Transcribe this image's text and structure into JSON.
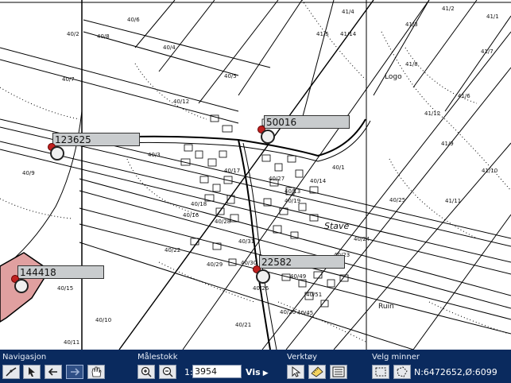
{
  "map": {
    "parcel_labels": [
      "40/7",
      "40/6",
      "40/5",
      "40/3",
      "40/4",
      "40/8",
      "40/12",
      "40/16",
      "40/18",
      "40/15",
      "40/22",
      "40/28",
      "40/21",
      "40/20",
      "40/19",
      "40/29",
      "40/31",
      "40/30",
      "40/45",
      "40/49",
      "40/51",
      "40/13",
      "40/14",
      "40/1",
      "40/2",
      "40/9",
      "40/10",
      "40/11",
      "40/17",
      "40/27",
      "40/23",
      "40/24",
      "40/25",
      "41/5",
      "41/4",
      "41/3",
      "41/2",
      "41/1",
      "41/6",
      "41/14",
      "41/7",
      "41/8",
      "41/9",
      "41/10",
      "41/11",
      "41/12",
      "40/26"
    ],
    "place_name": "Stave",
    "feature_labels": [
      "Ruin",
      "Logo"
    ],
    "markers": [
      {
        "id": "123625",
        "label": "123625"
      },
      {
        "id": "50016",
        "label": "50016"
      },
      {
        "id": "22582",
        "label": "22582"
      },
      {
        "id": "144418",
        "label": "144418"
      }
    ]
  },
  "toolbar": {
    "navigation": {
      "title": "Navigasjon",
      "buttons": [
        "draw-line-icon",
        "select-arrow-icon",
        "back-arrow-icon",
        "forward-arrow-icon",
        "pan-hand-icon"
      ]
    },
    "scale": {
      "title": "Målestokk",
      "prefix": "1:",
      "value": "3954",
      "submit_label": "Vis"
    },
    "tools": {
      "title": "Verktøy",
      "buttons": [
        "pointer-icon",
        "ruler-icon",
        "list-icon"
      ]
    },
    "select_monuments": {
      "title": "Velg minner",
      "buttons": [
        "rectangle-select-icon",
        "polygon-select-icon"
      ]
    },
    "coordinates": "N:6472652,Ø:6099"
  },
  "colors": {
    "toolbar_bg": "#0a2a5e",
    "marker_label_bg": "#c9ccce",
    "marker_dot": "#c0201f",
    "parcel_highlight": "#e0a0a0"
  }
}
